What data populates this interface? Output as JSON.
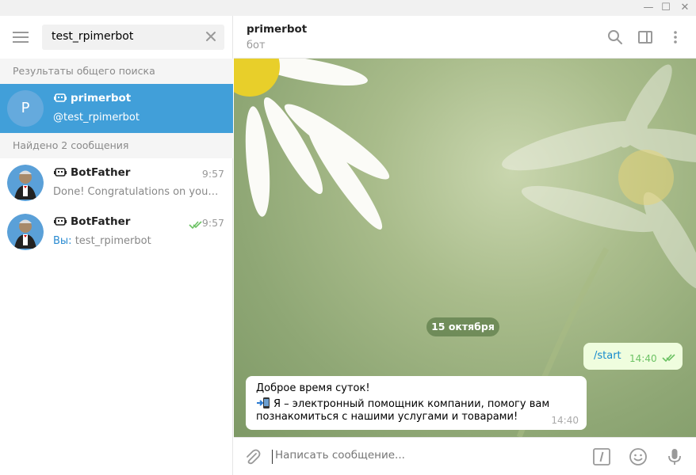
{
  "window": {
    "minimize": "—",
    "maximize": "☐",
    "close": "✕"
  },
  "sidebar": {
    "search": {
      "value": "test_rpimerbot"
    },
    "global_results_header": "Результаты общего поиска",
    "global_results": [
      {
        "title": "primerbot",
        "subtitle": "@test_rpimerbot",
        "avatar_letter": "P",
        "active": true
      }
    ],
    "found_header": "Найдено 2 сообщения",
    "messages": [
      {
        "title": "BotFather",
        "time": "9:57",
        "preview": "Done! Congratulations on your new bot. You will find it at",
        "prefix": ""
      },
      {
        "title": "BotFather",
        "time": "9:57",
        "preview": "test_rpimerbot",
        "prefix": "Вы: "
      }
    ]
  },
  "chat": {
    "title": "primerbot",
    "status": "бот",
    "date": "15 октября",
    "outgoing": {
      "text": "/start",
      "time": "14:40"
    },
    "incoming": {
      "line1": "Доброе время суток!",
      "line2": "Я – электронный помощник компании, помогу вам",
      "line3": "познакомиться с нашими услугами и товарами!",
      "time": "14:40"
    }
  },
  "composer": {
    "placeholder": "Написать сообщение..."
  },
  "colors": {
    "accent": "#419fd9",
    "outgoing_bubble": "#effdde",
    "read_ticks": "#6cc264"
  }
}
